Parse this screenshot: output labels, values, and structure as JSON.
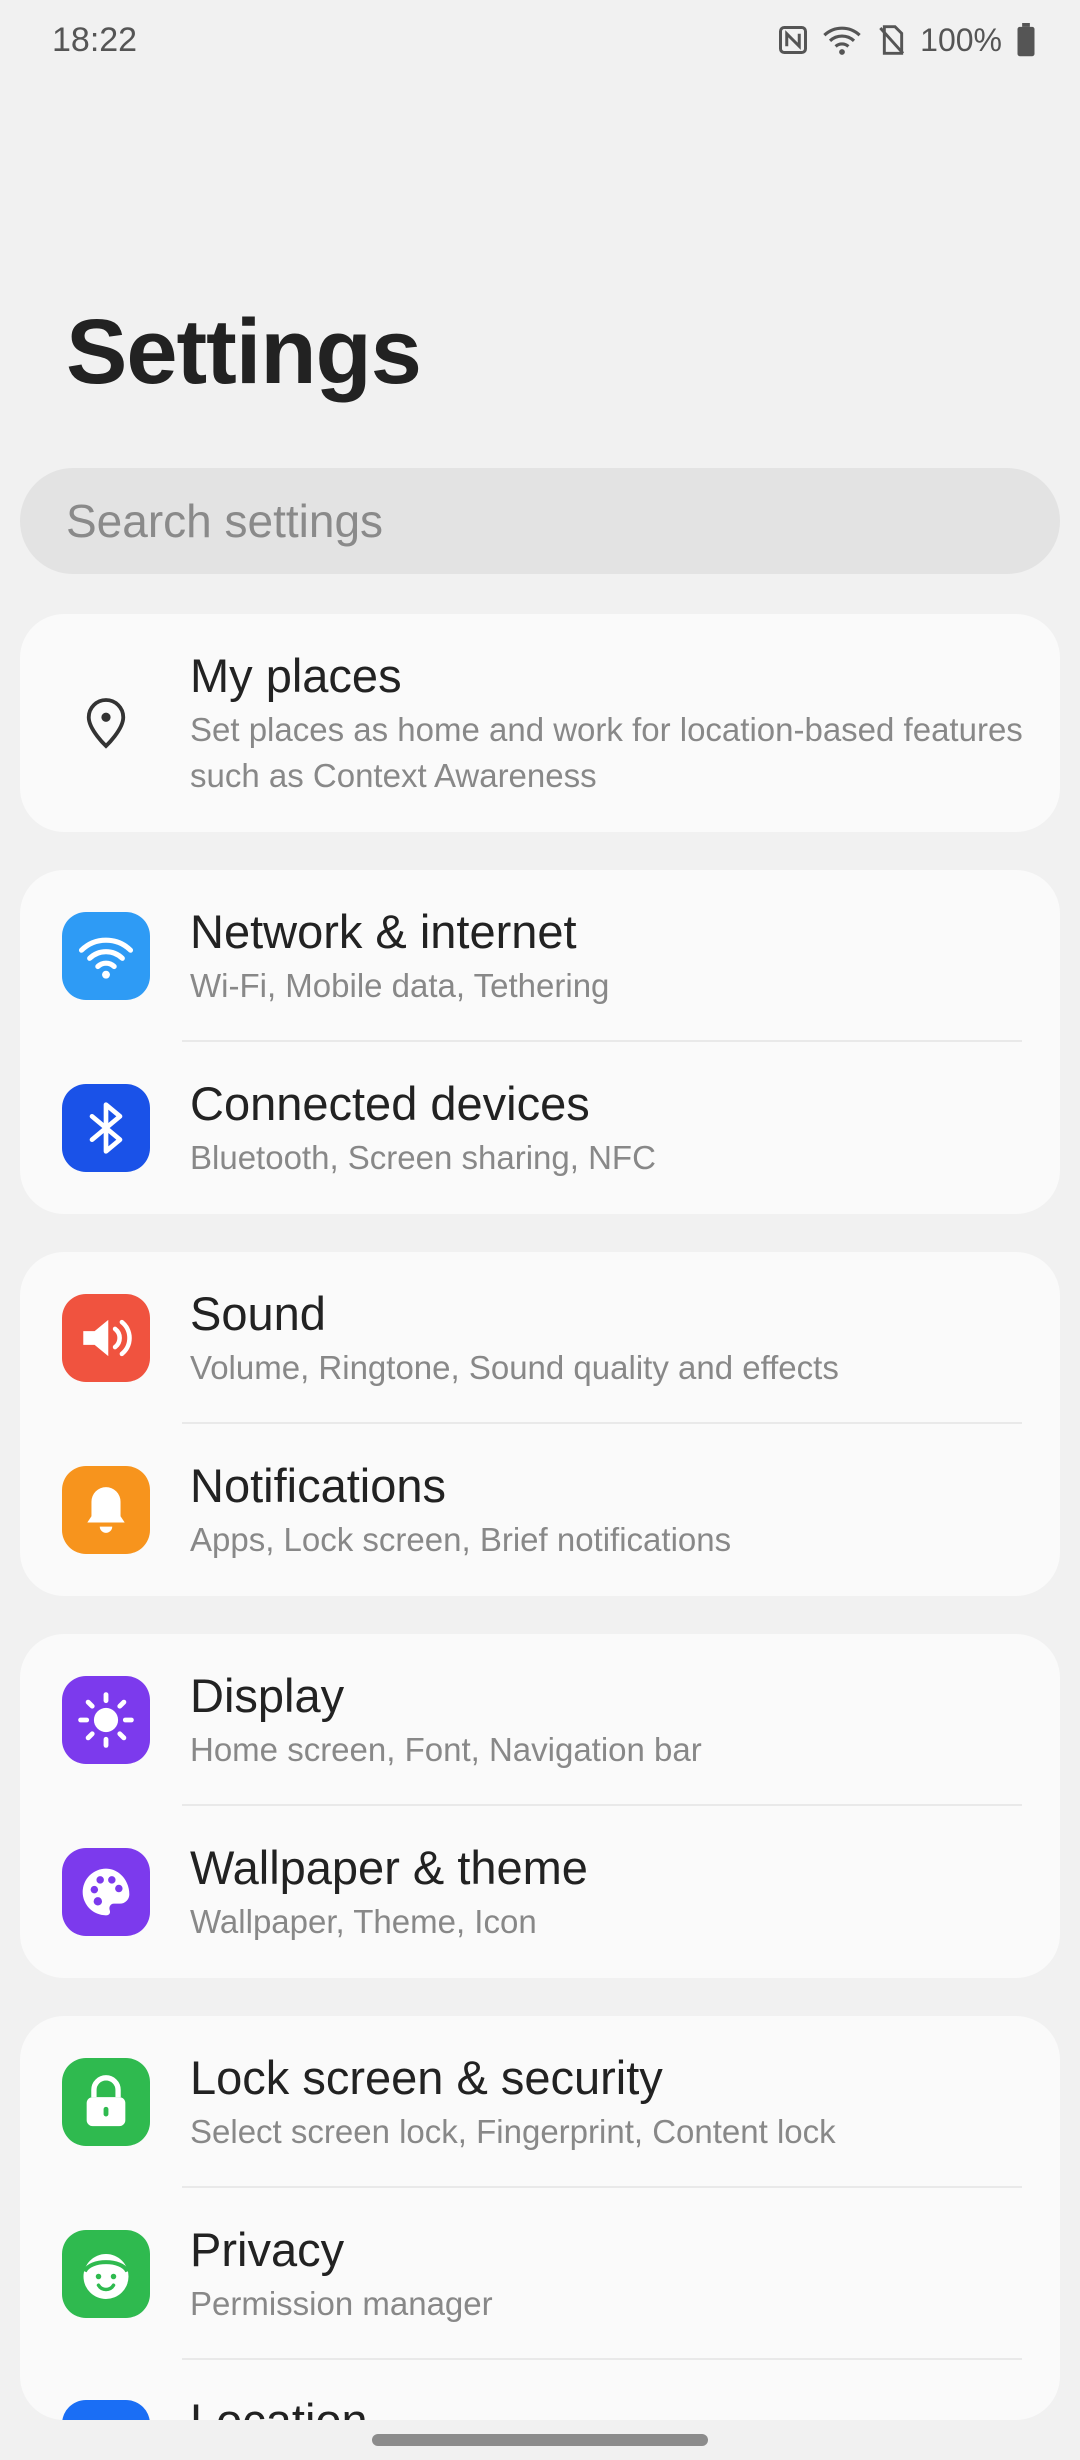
{
  "status": {
    "time": "18:22",
    "battery": "100%"
  },
  "header": {
    "title": "Settings"
  },
  "search": {
    "placeholder": "Search settings"
  },
  "groups": [
    {
      "items": [
        {
          "label": "My places",
          "sub": "Set places as home and work for location-based features such as Context Awareness",
          "icon": "location-pin-icon",
          "color": ""
        }
      ]
    },
    {
      "items": [
        {
          "label": "Network & internet",
          "sub": "Wi-Fi, Mobile data, Tethering",
          "icon": "wifi-icon",
          "color": "#2e9bf5"
        },
        {
          "label": "Connected devices",
          "sub": "Bluetooth, Screen sharing, NFC",
          "icon": "bluetooth-icon",
          "color": "#1a52e8"
        }
      ]
    },
    {
      "items": [
        {
          "label": "Sound",
          "sub": "Volume, Ringtone, Sound quality and effects",
          "icon": "speaker-icon",
          "color": "#f0533f"
        },
        {
          "label": "Notifications",
          "sub": "Apps, Lock screen, Brief notifications",
          "icon": "bell-icon",
          "color": "#f7941d"
        }
      ]
    },
    {
      "items": [
        {
          "label": "Display",
          "sub": "Home screen, Font, Navigation bar",
          "icon": "sun-icon",
          "color": "#7c3aed"
        },
        {
          "label": "Wallpaper & theme",
          "sub": "Wallpaper, Theme, Icon",
          "icon": "palette-icon",
          "color": "#7c3aed"
        }
      ]
    },
    {
      "items": [
        {
          "label": "Lock screen & security",
          "sub": "Select screen lock, Fingerprint, Content lock",
          "icon": "lock-icon",
          "color": "#2fba4f"
        },
        {
          "label": "Privacy",
          "sub": "Permission manager",
          "icon": "privacy-face-icon",
          "color": "#2fba4f"
        },
        {
          "label": "Location",
          "sub": "",
          "icon": "location-icon",
          "color": "#1a6ef5"
        }
      ]
    }
  ]
}
